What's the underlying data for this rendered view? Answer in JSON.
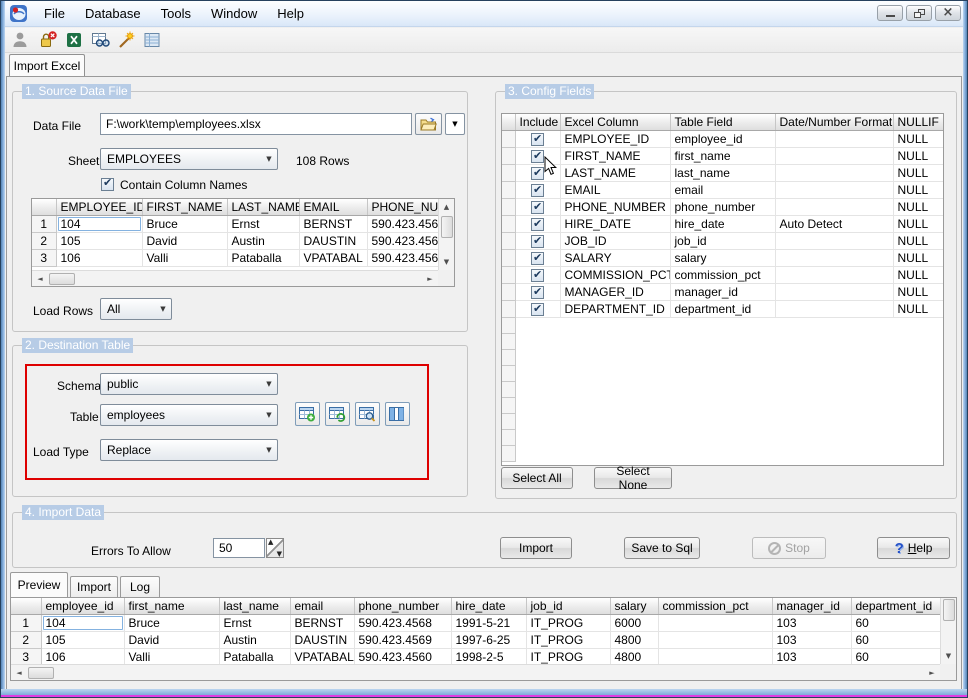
{
  "colors": {
    "highlight_red": "#de0000",
    "group_title_bg": "#b7cce6",
    "selection_border": "#84b2e0",
    "window_border_blue": "#7fa9d9"
  },
  "titlebar": {
    "menus": [
      "File",
      "Database",
      "Tools",
      "Window",
      "Help"
    ],
    "window_controls": [
      "minimize",
      "restore",
      "close"
    ],
    "app_icon": "import-excel-app-icon"
  },
  "toolbar": {
    "icons": [
      "user-icon",
      "disconnect-icon",
      "excel-icon",
      "view-data-icon",
      "wizard-icon",
      "list-view-icon"
    ]
  },
  "main_tab": {
    "label": "Import Excel"
  },
  "source": {
    "title": "1. Source Data File",
    "data_file_label": "Data File",
    "data_file_value": "F:\\work\\temp\\employees.xlsx",
    "sheet_label": "Sheet",
    "sheet_value": "EMPLOYEES",
    "rows_info": "108 Rows",
    "contain_column_names": "Contain Column Names",
    "grid": {
      "columns": [
        "EMPLOYEE_ID",
        "FIRST_NAME",
        "LAST_NAME",
        "EMAIL",
        "PHONE_NUM"
      ],
      "rows": [
        [
          "1",
          "104",
          "Bruce",
          "Ernst",
          "BERNST",
          "590.423.4568"
        ],
        [
          "2",
          "105",
          "David",
          "Austin",
          "DAUSTIN",
          "590.423.4569"
        ],
        [
          "3",
          "106",
          "Valli",
          "Pataballa",
          "VPATABAL",
          "590.423.4560"
        ]
      ]
    },
    "load_rows_label": "Load Rows",
    "load_rows_value": "All"
  },
  "destination": {
    "title": "2. Destination Table",
    "schema_label": "Schema",
    "schema_value": "public",
    "table_label": "Table",
    "table_value": "employees",
    "load_type_label": "Load Type",
    "load_type_value": "Replace",
    "tool_icons": [
      "new-table-icon",
      "refresh-table-icon",
      "view-table-icon",
      "table-columns-icon"
    ]
  },
  "config_fields": {
    "title": "3. Config Fields",
    "columns": [
      "Include",
      "Excel Column",
      "Table Field",
      "Date/Number Format",
      "NULLIF"
    ],
    "rows": [
      [
        "",
        true,
        "EMPLOYEE_ID",
        "employee_id",
        "",
        "NULL"
      ],
      [
        "",
        true,
        "FIRST_NAME",
        "first_name",
        "",
        "NULL"
      ],
      [
        "",
        true,
        "LAST_NAME",
        "last_name",
        "",
        "NULL"
      ],
      [
        "",
        true,
        "EMAIL",
        "email",
        "",
        "NULL"
      ],
      [
        "",
        true,
        "PHONE_NUMBER",
        "phone_number",
        "",
        "NULL"
      ],
      [
        "",
        true,
        "HIRE_DATE",
        "hire_date",
        "Auto Detect",
        "NULL"
      ],
      [
        "",
        true,
        "JOB_ID",
        "job_id",
        "",
        "NULL"
      ],
      [
        "",
        true,
        "SALARY",
        "salary",
        "",
        "NULL"
      ],
      [
        "",
        true,
        "COMMISSION_PCT",
        "commission_pct",
        "",
        "NULL"
      ],
      [
        "",
        true,
        "MANAGER_ID",
        "manager_id",
        "",
        "NULL"
      ],
      [
        "",
        true,
        "DEPARTMENT_ID",
        "department_id",
        "",
        "NULL"
      ]
    ],
    "select_all": "Select All",
    "select_none": "Select None"
  },
  "import_data": {
    "title": "4. Import Data",
    "errors_label": "Errors To Allow",
    "errors_value": "50",
    "import_btn": "Import",
    "save_btn": "Save to Sql",
    "stop_btn": "Stop",
    "help_btn": "Help"
  },
  "bottom_tabs": {
    "tabs": [
      "Preview",
      "Import",
      "Log"
    ],
    "active": "Preview"
  },
  "preview": {
    "columns": [
      "employee_id",
      "first_name",
      "last_name",
      "email",
      "phone_number",
      "hire_date",
      "job_id",
      "salary",
      "commission_pct",
      "manager_id",
      "department_id"
    ],
    "rows": [
      [
        "1",
        "104",
        "Bruce",
        "Ernst",
        "BERNST",
        "590.423.4568",
        "1991-5-21",
        "IT_PROG",
        "6000",
        "",
        "103",
        "60"
      ],
      [
        "2",
        "105",
        "David",
        "Austin",
        "DAUSTIN",
        "590.423.4569",
        "1997-6-25",
        "IT_PROG",
        "4800",
        "",
        "103",
        "60"
      ],
      [
        "3",
        "106",
        "Valli",
        "Pataballa",
        "VPATABAL",
        "590.423.4560",
        "1998-2-5",
        "IT_PROG",
        "4800",
        "",
        "103",
        "60"
      ]
    ]
  }
}
